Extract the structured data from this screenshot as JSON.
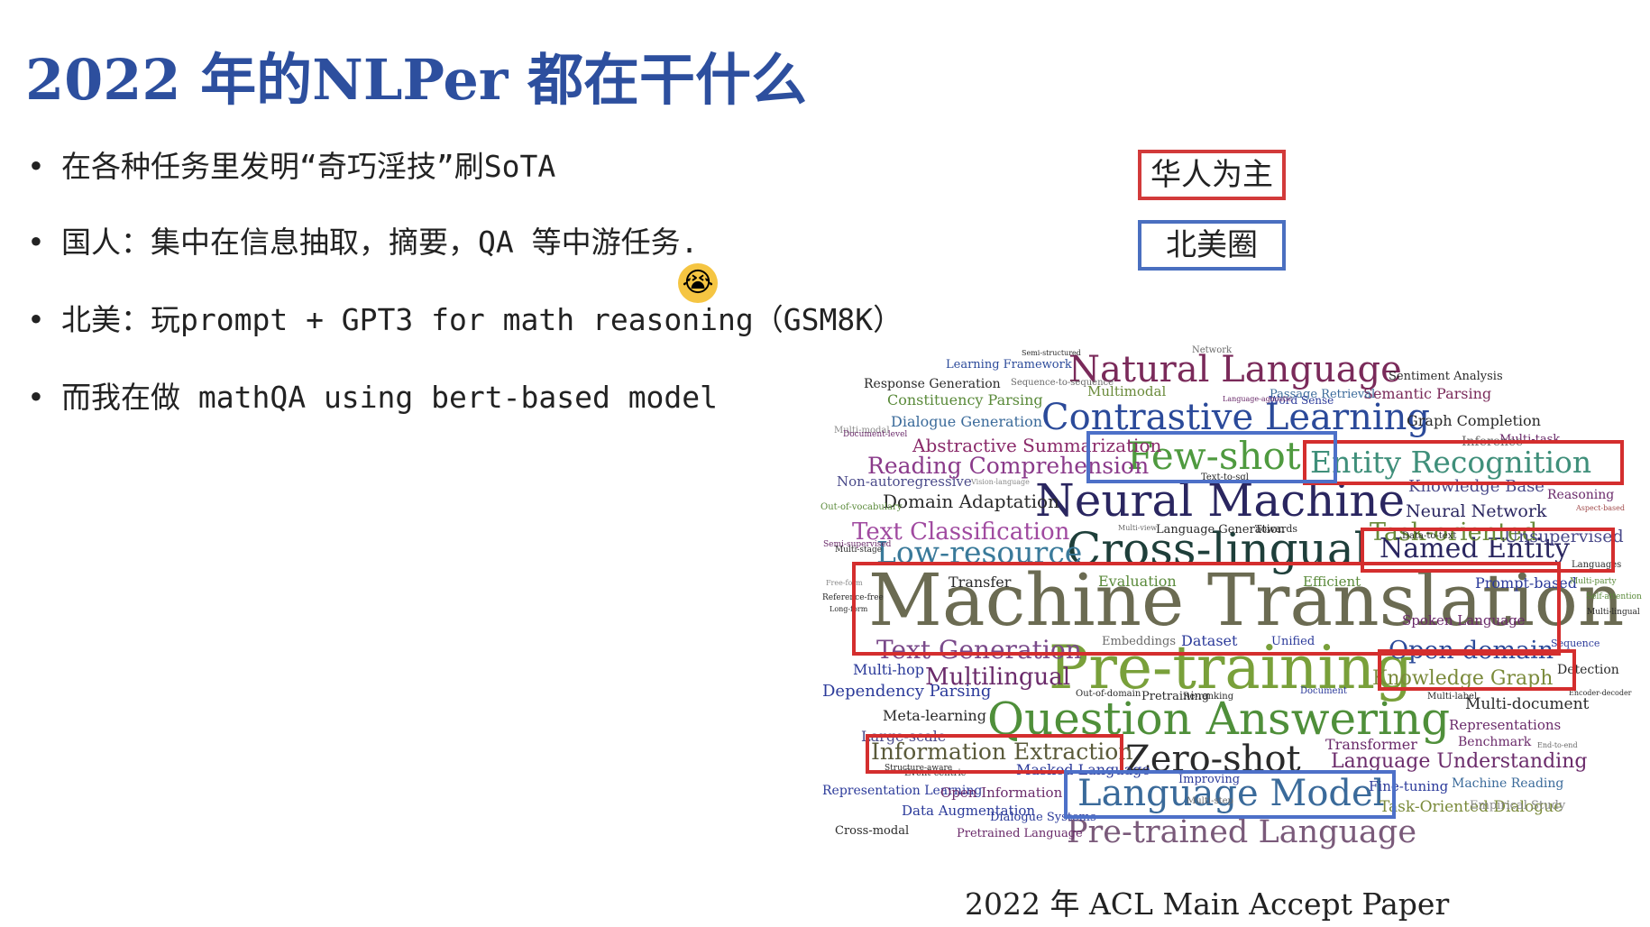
{
  "slide": {
    "title": "2022 年的NLPer 都在干什么",
    "bullets": [
      "在各种任务里发明“奇巧淫技”刷SoTA",
      "国人：集中在信息抽取，摘要，QA 等中游任务.",
      "北美：玩prompt + GPT3 for math reasoning（GSM8K）",
      "而我在做 mathQA using bert-based model"
    ],
    "bullet_marker": "•",
    "emoji_icon": "crying-face",
    "legend": {
      "red_label": "华人为主",
      "blue_label": "北美圈",
      "red_color": "#d42e2e",
      "blue_color": "#4d70c8"
    },
    "caption": "2022 年 ACL Main Accept Paper"
  },
  "wordcloud": {
    "words": [
      {
        "text": "Machine Translation",
        "color": "#6b6b52"
      },
      {
        "text": "Pre-training",
        "color": "#79a03a"
      },
      {
        "text": "Question Answering",
        "color": "#4f8f3a"
      },
      {
        "text": "Neural Machine",
        "color": "#2a2660"
      },
      {
        "text": "Cross-lingual",
        "color": "#1e3f3a"
      },
      {
        "text": "Contrastive Learning",
        "color": "#2b4a9a"
      },
      {
        "text": "Natural Language",
        "color": "#7a2a5a"
      },
      {
        "text": "Few-shot",
        "color": "#4f9a3f"
      },
      {
        "text": "Entity Recognition",
        "color": "#3f8f7a"
      },
      {
        "text": "Language Model",
        "color": "#3a6a9a"
      },
      {
        "text": "Pre-trained Language",
        "color": "#7a5a7a"
      },
      {
        "text": "Zero-shot",
        "color": "#2a2a2a"
      },
      {
        "text": "Named Entity",
        "color": "#2a2660"
      },
      {
        "text": "Open-domain",
        "color": "#2b4a9a"
      },
      {
        "text": "Low-resource",
        "color": "#3a7a9a"
      },
      {
        "text": "Text Generation",
        "color": "#7a4a8a"
      },
      {
        "text": "Multilingual",
        "color": "#6a2a6a"
      },
      {
        "text": "Knowledge Graph",
        "color": "#7a8a3a"
      },
      {
        "text": "Information Extraction",
        "color": "#5a5a3a"
      },
      {
        "text": "Reading Comprehension",
        "color": "#8a3a8a"
      },
      {
        "text": "Text Classification",
        "color": "#a04aa0"
      },
      {
        "text": "Abstractive Summarization",
        "color": "#8a2a6a"
      },
      {
        "text": "Task-oriented",
        "color": "#6a8a3a"
      },
      {
        "text": "Domain Adaptation",
        "color": "#2a2a2a"
      },
      {
        "text": "Dependency Parsing",
        "color": "#2b3a9a"
      },
      {
        "text": "Neural Network",
        "color": "#2a2660"
      },
      {
        "text": "Language Understanding",
        "color": "#6a2a6a"
      },
      {
        "text": "Knowledge Base",
        "color": "#4a4a8a"
      },
      {
        "text": "Graph Completion",
        "color": "#2a2a2a"
      },
      {
        "text": "Semantic Parsing",
        "color": "#7a2a5a"
      },
      {
        "text": "Dialogue Generation",
        "color": "#3a6a9a"
      },
      {
        "text": "Constituency Parsing",
        "color": "#5a8a3a"
      },
      {
        "text": "Response Generation",
        "color": "#2a2a2a"
      },
      {
        "text": "Learning Framework",
        "color": "#2b4a9a"
      },
      {
        "text": "Multimodal",
        "color": "#6a8a3a"
      },
      {
        "text": "Sentiment Analysis",
        "color": "#2a2a2a"
      },
      {
        "text": "Passage Retrieval",
        "color": "#3a6a9a"
      },
      {
        "text": "Spoken Language",
        "color": "#6a2a6a"
      },
      {
        "text": "Word Sense",
        "color": "#2b3a9a"
      },
      {
        "text": "Reasoning",
        "color": "#6a2a6a"
      },
      {
        "text": "Unsupervised",
        "color": "#4a4a8a"
      },
      {
        "text": "Prompt-based",
        "color": "#2b3a9a"
      },
      {
        "text": "Multi-hop",
        "color": "#2b3a9a"
      },
      {
        "text": "Meta-learning",
        "color": "#2a2a2a"
      },
      {
        "text": "Transfer",
        "color": "#2a2a2a"
      },
      {
        "text": "Evaluation",
        "color": "#5a8a3a"
      },
      {
        "text": "Efficient",
        "color": "#5a8a3a"
      },
      {
        "text": "Dataset",
        "color": "#2b3a9a"
      },
      {
        "text": "Embeddings",
        "color": "#6a6a6a"
      },
      {
        "text": "Unified",
        "color": "#2b3a9a"
      },
      {
        "text": "Transformer",
        "color": "#6a2a6a"
      },
      {
        "text": "Benchmark",
        "color": "#6a2a6a"
      },
      {
        "text": "Representations",
        "color": "#6a2a6a"
      },
      {
        "text": "Multi-document",
        "color": "#2a2a2a"
      },
      {
        "text": "Detection",
        "color": "#2a2a2a"
      },
      {
        "text": "Fine-tuning",
        "color": "#2b3a9a"
      },
      {
        "text": "Machine Reading",
        "color": "#3a6a9a"
      },
      {
        "text": "Task-Oriented Dialogue",
        "color": "#7a8a3a"
      },
      {
        "text": "Empirical Study",
        "color": "#8a8a8a"
      },
      {
        "text": "Representation Learning",
        "color": "#2b3a9a"
      },
      {
        "text": "Open Information",
        "color": "#6a2a6a"
      },
      {
        "text": "Data Augmentation",
        "color": "#2b3a9a"
      },
      {
        "text": "Dialogue Systems",
        "color": "#2b3a9a"
      },
      {
        "text": "Cross-modal",
        "color": "#2a2a2a"
      },
      {
        "text": "Pretrained Language",
        "color": "#6a2a6a"
      },
      {
        "text": "Masked Language",
        "color": "#2b3a9a"
      },
      {
        "text": "Large-scale",
        "color": "#4a4a8a"
      },
      {
        "text": "Non-autoregressive",
        "color": "#4a4a8a"
      },
      {
        "text": "Improving",
        "color": "#2b3a9a"
      },
      {
        "text": "Pretraining",
        "color": "#2a2a2a"
      },
      {
        "text": "Inference",
        "color": "#6a6a6a"
      },
      {
        "text": "Multi-task",
        "color": "#6a2a6a"
      },
      {
        "text": "Language Generation",
        "color": "#2a2a2a"
      },
      {
        "text": "Towards",
        "color": "#2a2a2a"
      },
      {
        "text": "Network",
        "color": "#6a6a6a"
      },
      {
        "text": "Sequence-to-sequence",
        "color": "#6a6a6a"
      },
      {
        "text": "Multi-modal",
        "color": "#8a8a8a"
      },
      {
        "text": "Document-level",
        "color": "#6a2a6a"
      },
      {
        "text": "Out-of-vocabulary",
        "color": "#5a8a3a"
      },
      {
        "text": "Semi-supervised",
        "color": "#6a2a6a"
      },
      {
        "text": "Out-of-domain",
        "color": "#2a2a2a"
      },
      {
        "text": "Re-ranking",
        "color": "#2a2a2a"
      },
      {
        "text": "Document",
        "color": "#2b3a9a"
      },
      {
        "text": "Data-to-text",
        "color": "#2a2a2a"
      },
      {
        "text": "Sequence",
        "color": "#2b3a9a"
      },
      {
        "text": "Multi-label",
        "color": "#2a2a2a"
      },
      {
        "text": "Languages",
        "color": "#2a2a2a"
      },
      {
        "text": "Multi-party",
        "color": "#5a8a3a"
      },
      {
        "text": "Self-attention",
        "color": "#5a8a3a"
      },
      {
        "text": "Multi-lingual",
        "color": "#2a2a2a"
      },
      {
        "text": "Aspect-based",
        "color": "#a04a4a"
      },
      {
        "text": "Event-centric",
        "color": "#2a2a2a"
      },
      {
        "text": "Structure-aware",
        "color": "#2a2a2a"
      },
      {
        "text": "End-to-end",
        "color": "#6a6a6a"
      },
      {
        "text": "Encoder-decoder",
        "color": "#2a2a2a"
      },
      {
        "text": "Semi-structured",
        "color": "#2a2a2a"
      },
      {
        "text": "Vision-language",
        "color": "#8a8a8a"
      },
      {
        "text": "Language-agnostic",
        "color": "#6a2a6a"
      },
      {
        "text": "Multi-view",
        "color": "#6a6a6a"
      },
      {
        "text": "Multi-step",
        "color": "#6a6a6a"
      },
      {
        "text": "Free-form",
        "color": "#8a8a8a"
      },
      {
        "text": "Reference-free",
        "color": "#2a2a2a"
      },
      {
        "text": "Long-form",
        "color": "#2a2a2a"
      },
      {
        "text": "Text-to-sql",
        "color": "#2a2a2a"
      },
      {
        "text": "Multi-stage",
        "color": "#2a2a2a"
      },
      {
        "text": "Self-supervised",
        "color": "#8a8a8a"
      },
      {
        "text": "Multi-domain",
        "color": "#2a2a2a"
      }
    ]
  }
}
